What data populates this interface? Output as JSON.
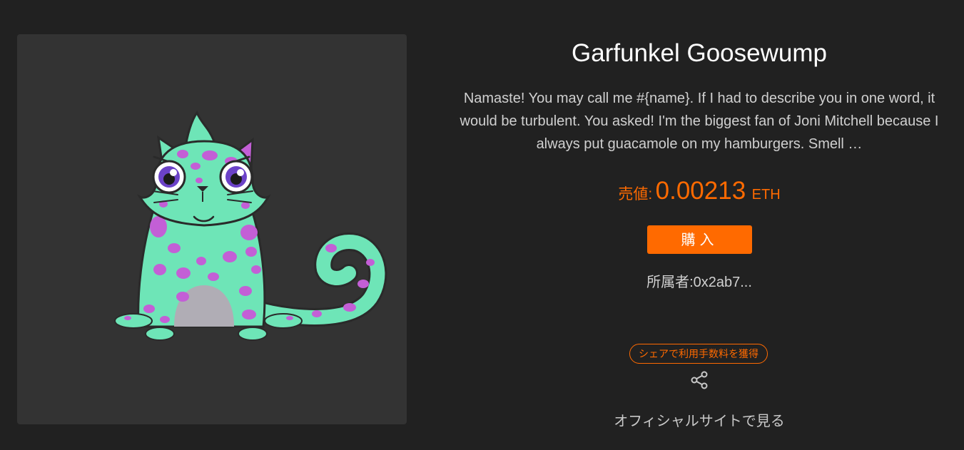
{
  "kitty": {
    "name": "Garfunkel Goosewump",
    "description": "Namaste! You may call me #{name}. If I had to describe you in one word, it would be turbulent. You asked! I'm the biggest fan of Joni Mitchell because I always put guacamole on my hamburgers. Smell …",
    "image_alt": "cat illustration"
  },
  "price": {
    "label": "売値:",
    "value": "0.00213",
    "unit": "ETH"
  },
  "buy_button": {
    "label": "購入"
  },
  "owner": {
    "text": "所属者:0x2ab7..."
  },
  "share": {
    "badge": "シェアで利用手数料を獲得",
    "icon": "share-icon"
  },
  "official_link": {
    "label": "オフィシャルサイトで見る"
  },
  "colors": {
    "background": "#212121",
    "card": "#333333",
    "accent": "#ff6a00",
    "cat_body": "#6ee5b7",
    "cat_spots": "#c35fd6"
  }
}
